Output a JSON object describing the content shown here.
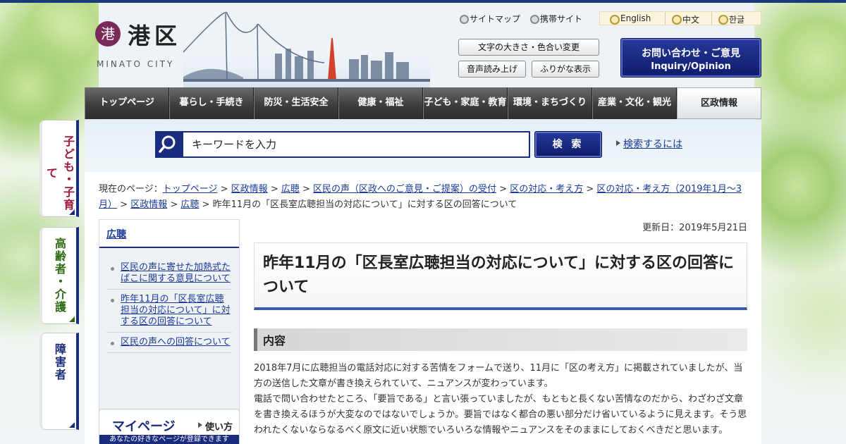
{
  "header": {
    "logo_mark": "港",
    "logo_name": "港区",
    "logo_roman": "MINATO CITY",
    "util_links": [
      "サイトマップ",
      "携帯サイト"
    ],
    "languages": [
      "English",
      "中文",
      "한글"
    ],
    "buttons": {
      "text_size": "文字の大きさ・色合い変更",
      "read_aloud": "音声読み上げ",
      "furigana": "ふりがな表示"
    },
    "inquiry": {
      "line1": "お問い合わせ・ご意見",
      "line2": "Inquiry/Opinion"
    }
  },
  "nav": {
    "items": [
      "トップページ",
      "暮らし・手続き",
      "防災・生活安全",
      "健康・福祉",
      "子ども・家庭・教育",
      "環境・まちづくり",
      "産業・文化・観光",
      "区政情報"
    ],
    "active_index": 7
  },
  "search": {
    "placeholder": "キーワードを入力",
    "button": "検 索",
    "help": "検索するには"
  },
  "side_tabs": [
    {
      "label": "子ども・子育て",
      "color": "#a0183a"
    },
    {
      "label": "高齢者・介護",
      "color": "#2e6a12"
    },
    {
      "label": "障害者",
      "color": "#1a2c7e"
    }
  ],
  "breadcrumb": {
    "prefix": "現在のページ：",
    "items": [
      "トップページ",
      "区政情報",
      "広聴",
      "区民の声（区政へのご意見・ご提案）の受付",
      "区の対応・考え方",
      "区の対応・考え方（2019年1月～3月）",
      "区政情報",
      "広聴"
    ],
    "current": "昨年11月の「区長室広聴担当の対応について」に対する区の回答について"
  },
  "sidebar": {
    "heading": "広聴",
    "items": [
      "区民の声に寄せた加熱式たばこに関する意見について",
      "昨年11月の「区長室広聴担当の対応について」に対する区の回答について",
      "区民の声への回答について"
    ]
  },
  "mypage": {
    "title": "マイページ",
    "howto": "使い方",
    "desc": "あなたの好きなページが登録できます"
  },
  "page": {
    "updated": "更新日：2019年5月21日",
    "title": "昨年11月の「区長室広聴担当の対応について」に対する区の回答について",
    "section": "内容",
    "paragraphs": [
      "2018年7月に広聴担当の電話対応に対する苦情をフォームで送り、11月に「区の考え方」に掲載されていましたが、当方の送信した文章が書き換えられていて、ニュアンスが変わっています。",
      "電話で問い合わせたところ、「要旨である」と言い張っていましたが、もともと長くない苦情なのだから、わざわざ文章を書き換えるほうが大変なのではないでしょうか。要旨ではなく都合の悪い部分だけ省いているように見えます。そう思われたくないならなるべく原文に近い状態でいろいろな情報やニュアンスをそのままにしておくべきだと思います。"
    ]
  }
}
